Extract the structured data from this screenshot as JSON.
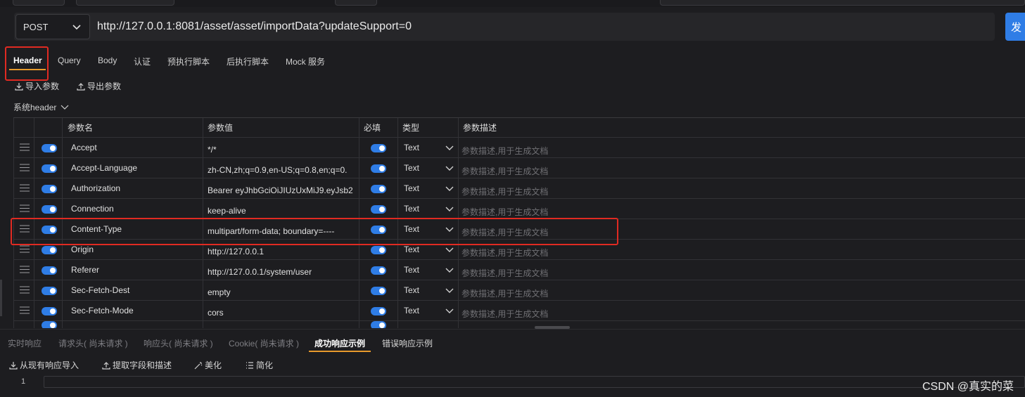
{
  "request": {
    "method": "POST",
    "url": "http://127.0.0.1:8081/asset/asset/importData?updateSupport=0",
    "send_label": "发"
  },
  "tabs": [
    {
      "label": "Header",
      "active": true
    },
    {
      "label": "Query"
    },
    {
      "label": "Body"
    },
    {
      "label": "认证"
    },
    {
      "label": "预执行脚本"
    },
    {
      "label": "后执行脚本"
    },
    {
      "label": "Mock 服务"
    }
  ],
  "actions": {
    "import_label": "导入参数",
    "export_label": "导出参数"
  },
  "system_header_label": "系统header",
  "table": {
    "columns": {
      "name": "参数名",
      "value": "参数值",
      "required": "必填",
      "type": "类型",
      "desc": "参数描述"
    },
    "rows": [
      {
        "name": "Accept",
        "value": "*/*",
        "type": "Text",
        "desc_placeholder": "参数描述,用于生成文档"
      },
      {
        "name": "Accept-Language",
        "value": "zh-CN,zh;q=0.9,en-US;q=0.8,en;q=0.",
        "type": "Text",
        "desc_placeholder": "参数描述,用于生成文档"
      },
      {
        "name": "Authorization",
        "value": "Bearer eyJhbGciOiJIUzUxMiJ9.eyJsb2",
        "type": "Text",
        "desc_placeholder": "参数描述,用于生成文档"
      },
      {
        "name": "Connection",
        "value": "keep-alive",
        "type": "Text",
        "desc_placeholder": "参数描述,用于生成文档"
      },
      {
        "name": "Content-Type",
        "value": "multipart/form-data; boundary=----",
        "type": "Text",
        "desc_placeholder": "参数描述,用于生成文档"
      },
      {
        "name": "Origin",
        "value": "http://127.0.0.1",
        "type": "Text",
        "desc_placeholder": "参数描述,用于生成文档"
      },
      {
        "name": "Referer",
        "value": "http://127.0.0.1/system/user",
        "type": "Text",
        "desc_placeholder": "参数描述,用于生成文档"
      },
      {
        "name": "Sec-Fetch-Dest",
        "value": "empty",
        "type": "Text",
        "desc_placeholder": "参数描述,用于生成文档"
      },
      {
        "name": "Sec-Fetch-Mode",
        "value": "cors",
        "type": "Text",
        "desc_placeholder": "参数描述,用于生成文档"
      }
    ]
  },
  "response_tabs": [
    {
      "label": "实时响应"
    },
    {
      "label": "请求头( 尚未请求 )"
    },
    {
      "label": "响应头( 尚未请求 )"
    },
    {
      "label": "Cookie( 尚未请求 )"
    },
    {
      "label": "成功响应示例",
      "active": true
    },
    {
      "label": "错误响应示例"
    }
  ],
  "response_actions": {
    "import_label": "从现有响应导入",
    "extract_label": "提取字段和描述",
    "beautify_label": "美化",
    "simplify_label": "简化"
  },
  "editor": {
    "line_number": "1"
  },
  "watermark": "CSDN @真实的菜",
  "colors": {
    "accent": "#2f7de6",
    "tab_underline": "#e89a2c",
    "highlight": "#e02a22"
  }
}
